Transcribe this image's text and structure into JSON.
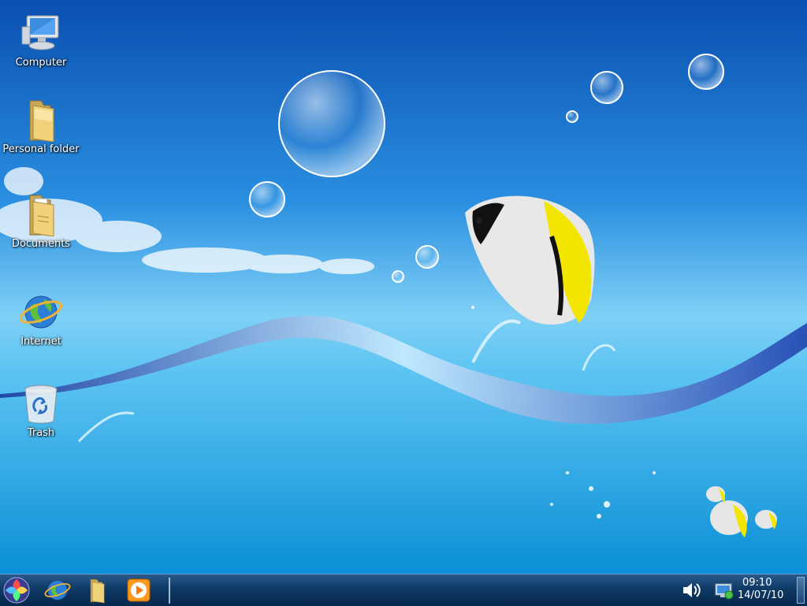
{
  "desktop_icons": [
    {
      "label": "Computer",
      "icon": "computer-icon"
    },
    {
      "label": "Personal folder",
      "icon": "folder-icon"
    },
    {
      "label": "Documents",
      "icon": "documents-folder-icon"
    },
    {
      "label": "Internet",
      "icon": "internet-globe-icon"
    },
    {
      "label": "Trash",
      "icon": "trash-icon"
    }
  ],
  "taskbar": {
    "launchers": [
      "start-menu-icon",
      "internet-globe-icon",
      "file-manager-icon",
      "media-player-icon"
    ],
    "tray": [
      "volume-icon",
      "network-icon"
    ],
    "clock": {
      "time": "09:10",
      "date": "14/07/10"
    }
  },
  "colors": {
    "sky_top": "#0b57b8",
    "sky_mid": "#4fb2ec",
    "water": "#1aa3e6",
    "fish_yellow": "#f2e600"
  }
}
